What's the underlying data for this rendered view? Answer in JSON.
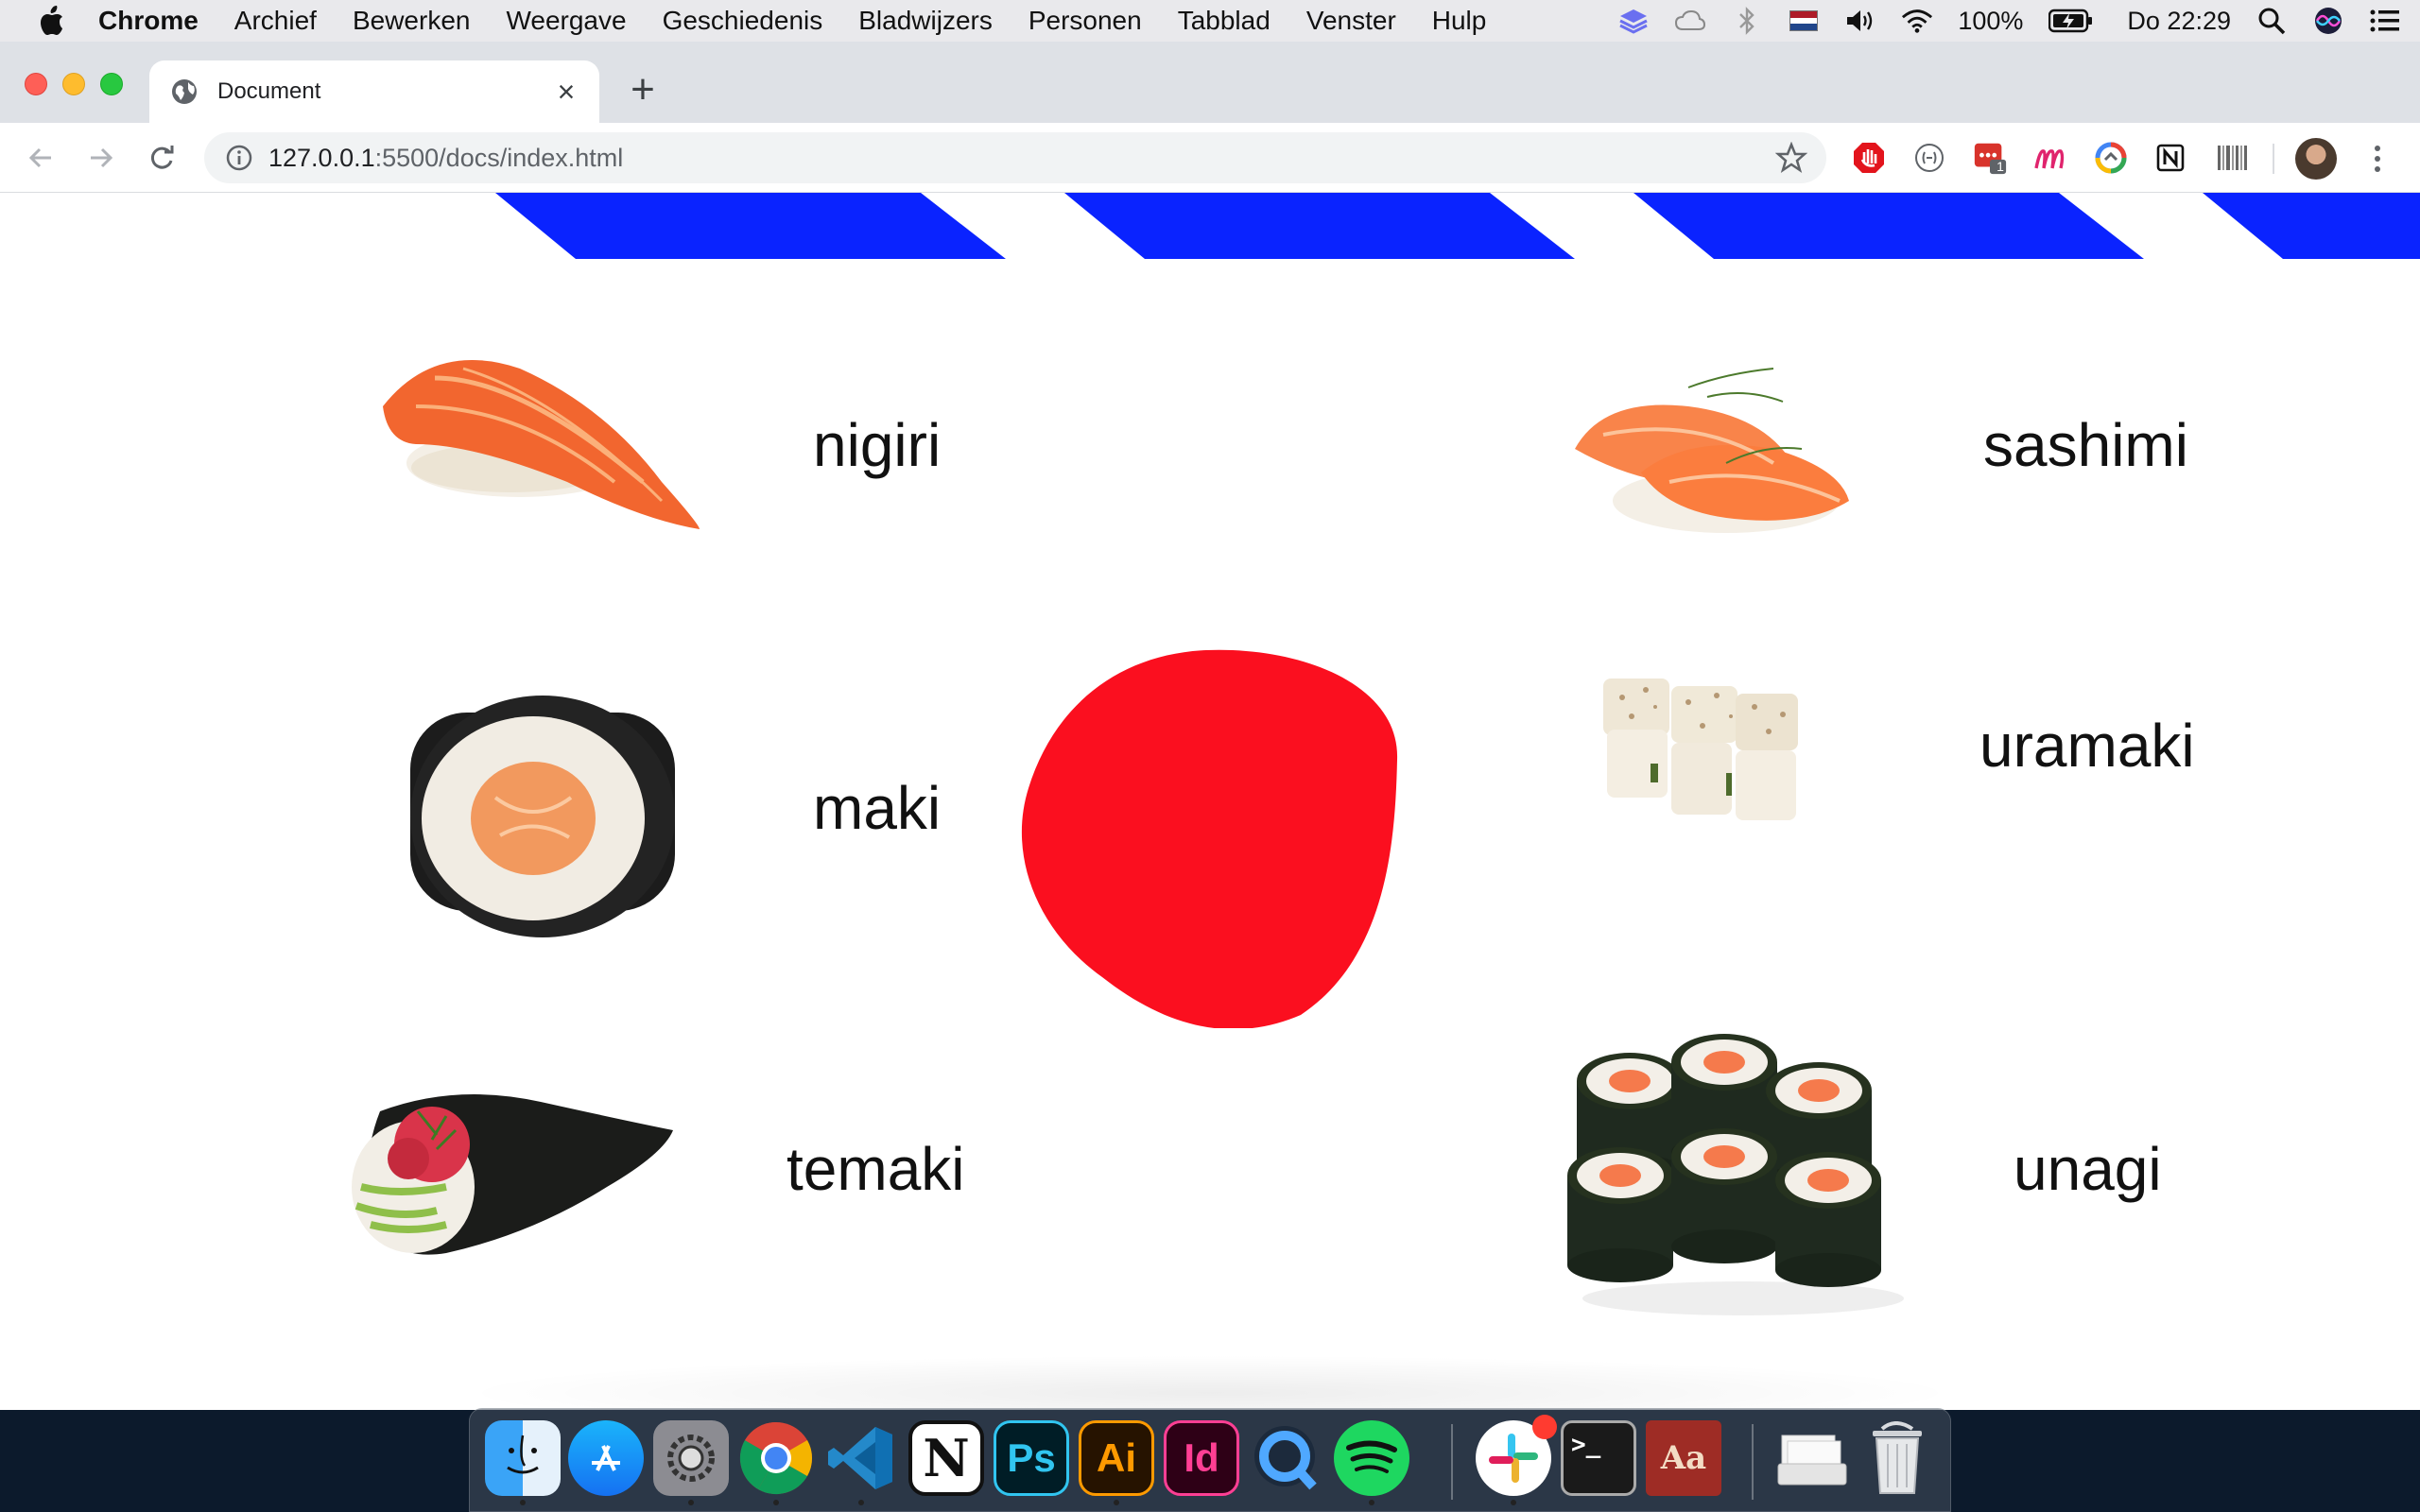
{
  "menubar": {
    "app_name": "Chrome",
    "items": [
      "Archief",
      "Bewerken",
      "Weergave",
      "Geschiedenis",
      "Bladwijzers",
      "Personen",
      "Tabblad",
      "Venster",
      "Hulp"
    ],
    "battery": "100%",
    "clock": "Do 22:29"
  },
  "browser": {
    "tab_title": "Document",
    "url_host": "127.0.0.1",
    "url_path": ":5500/docs/index.html",
    "extension_badge": "1"
  },
  "page": {
    "colors": {
      "stripe": "#0a23ff",
      "blob": "#fb0f1f"
    },
    "items": [
      {
        "label": "nigiri",
        "icon": "nigiri-image"
      },
      {
        "label": "sashimi",
        "icon": "sashimi-image"
      },
      {
        "label": "maki",
        "icon": "maki-image"
      },
      {
        "label": "uramaki",
        "icon": "uramaki-image"
      },
      {
        "label": "temaki",
        "icon": "temaki-image"
      },
      {
        "label": "unagi",
        "icon": "unagi-image"
      }
    ]
  },
  "dock": {
    "apps": [
      "finder-icon",
      "app-store-icon",
      "system-preferences-icon",
      "chrome-icon",
      "vscode-icon",
      "notion-icon",
      "photoshop-icon",
      "illustrator-icon",
      "indesign-icon",
      "quicktime-icon",
      "spotify-icon",
      "slack-icon",
      "terminal-icon",
      "dictionary-icon",
      "downloads-icon",
      "trash-icon"
    ],
    "ps_label": "Ps",
    "ai_label": "Ai",
    "id_label": "Id",
    "notion_label": "N",
    "dict_label": "Aa",
    "term_label": ">_"
  }
}
